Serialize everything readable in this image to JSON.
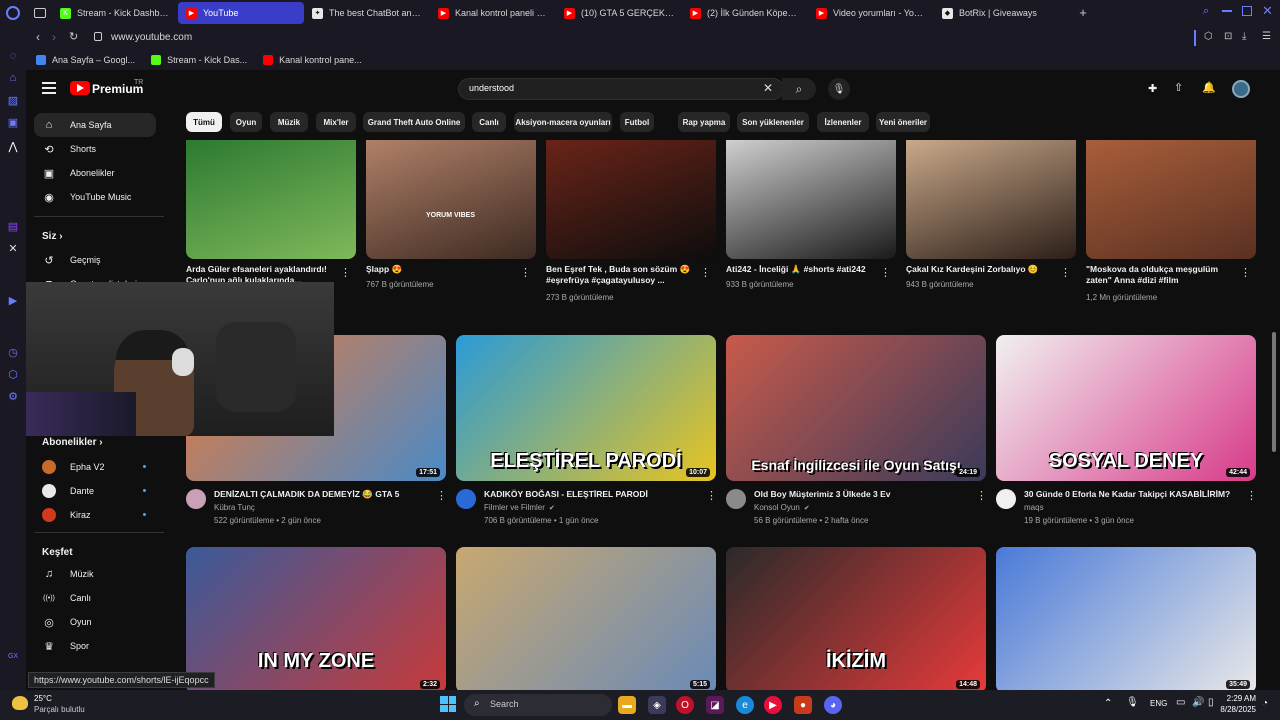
{
  "browser": {
    "tabs": [
      {
        "label": "Stream - Kick Dashboard",
        "color": "#53fc18",
        "glyph": "K"
      },
      {
        "label": "YouTube",
        "color": "#ff0000",
        "glyph": "▶",
        "active": true
      },
      {
        "label": "The best ChatBot and W...",
        "color": "#e8e8e8",
        "glyph": "✦"
      },
      {
        "label": "Kanal kontrol paneli - You...",
        "color": "#ff0000",
        "glyph": "▶"
      },
      {
        "label": "(10) GTA 5 GERÇEK HAYA...",
        "color": "#ff0000",
        "glyph": "▶"
      },
      {
        "label": "(2) İlk Günden Köpekbalığ...",
        "color": "#ff0000",
        "glyph": "▶"
      },
      {
        "label": "Video yorumları - YouTub...",
        "color": "#ff0000",
        "glyph": "▶"
      },
      {
        "label": "BotRix | Giveaways",
        "color": "#e8e8e8",
        "glyph": "◆"
      }
    ],
    "url": "www.youtube.com",
    "bookmarks": [
      {
        "label": "Ana Sayfa – Googl...",
        "color": "#4285f4"
      },
      {
        "label": "Stream - Kick Das...",
        "color": "#53fc18"
      },
      {
        "label": "Kanal kontrol pane...",
        "color": "#ff0000"
      }
    ],
    "status_url": "https://www.youtube.com/shorts/lE-ijEqopcc"
  },
  "youtube": {
    "logo": "Premium",
    "logo_region": "TR",
    "search_value": "understood",
    "sidebar": {
      "main": [
        {
          "label": "Ana Sayfa",
          "icon": "home-icon",
          "glyph": "⌂",
          "active": true
        },
        {
          "label": "Shorts",
          "icon": "shorts-icon",
          "glyph": "⟲"
        },
        {
          "label": "Abonelikler",
          "icon": "subscriptions-icon",
          "glyph": "▣"
        },
        {
          "label": "YouTube Music",
          "icon": "music-icon",
          "glyph": "◉"
        }
      ],
      "you_heading": "Siz",
      "you_items": [
        {
          "label": "Geçmiş",
          "icon": "history-icon",
          "glyph": "↺"
        },
        {
          "label": "Oynatma listeleri",
          "icon": "playlists-icon",
          "glyph": "≡"
        }
      ],
      "subs_heading": "Abonelikler",
      "subs": [
        {
          "label": "Epha V2",
          "color": "#c86a2a"
        },
        {
          "label": "Dante",
          "color": "#e8e8e8"
        },
        {
          "label": "Kiraz",
          "color": "#d23a1e"
        }
      ],
      "explore_heading": "Keşfet",
      "explore": [
        {
          "label": "Müzik",
          "icon": "music-note-icon",
          "glyph": "♫"
        },
        {
          "label": "Canlı",
          "icon": "live-icon",
          "glyph": "((•))"
        },
        {
          "label": "Oyun",
          "icon": "gaming-icon",
          "glyph": "◎"
        },
        {
          "label": "Spor",
          "icon": "trophy-icon",
          "glyph": "♛"
        }
      ]
    },
    "chips": [
      "Tümü",
      "Oyun",
      "Müzik",
      "Mix'ler",
      "Grand Theft Auto Online",
      "Canlı",
      "Aksiyon-macera oyunları",
      "Futbol",
      "Rap yapma",
      "Son yüklenenler",
      "İzlenenler",
      "Yeni öneriler"
    ],
    "shorts": [
      {
        "title": "Arda Güler efsaneleri ayaklandırdı! Carlo'nun ağlı kulaklarında...",
        "views": "",
        "colors": [
          "#2d7a32",
          "#7fb85a"
        ]
      },
      {
        "title": "Şlapp 😍",
        "views": "767 B görüntüleme",
        "colors": [
          "#b08068",
          "#3d2a22"
        ],
        "overlay": "YORUM VIBES"
      },
      {
        "title": "Ben Eşref Tek , Buda son sözüm 😍 #eşrefrüya #çagatayulusoy ...",
        "views": "273 B görüntüleme",
        "colors": [
          "#6a2418",
          "#0d0d0d"
        ]
      },
      {
        "title": "Ati242 - İnceliği 🙏 #shorts #ati242",
        "views": "933 B görüntüleme",
        "colors": [
          "#cfcfcf",
          "#1a1a1a"
        ]
      },
      {
        "title": "Çakal Kız Kardeşini Zorbalıyo 😊",
        "views": "943 B görüntüleme",
        "colors": [
          "#c9a98a",
          "#2c1e18"
        ]
      },
      {
        "title": "\"Moskova da oldukça meşgulüm zaten\" Anna #dizi #film",
        "views": "1,2 Mn görüntüleme",
        "colors": [
          "#a85e3a",
          "#5a3022"
        ]
      }
    ],
    "videos": [
      {
        "title": "DENİZALTI ÇALMADIK DA DEMEYİZ 😂 GTA 5",
        "channel": "Kübra Tunç",
        "verified": false,
        "views": "522 görüntüleme",
        "age": "2 gün önce",
        "duration": "17:51",
        "colors": [
          "#e87a3a",
          "#4a8ac8"
        ],
        "overlay": "",
        "avatar": "#c9a0b8"
      },
      {
        "title": "KADIKÖY BOĞASI - ELEŞTİREL PARODİ",
        "channel": "Filmler ve Filmler",
        "verified": true,
        "views": "706 B görüntüleme",
        "age": "1 gün önce",
        "duration": "10:07",
        "colors": [
          "#2a9ad8",
          "#e8c420"
        ],
        "overlay": "ELEŞTİREL PARODİ",
        "avatar": "#2a6ad8"
      },
      {
        "title": "Old Boy Müşterimiz 3 Ülkede 3 Ev",
        "channel": "Konsol Oyun",
        "verified": true,
        "views": "56 B görüntüleme",
        "age": "2 hafta önce",
        "duration": "24:19",
        "colors": [
          "#c85a4a",
          "#3a3a5a"
        ],
        "overlay": "Esnaf İngilizcesi ile Oyun Satışı",
        "avatar": "#8a8a8a"
      },
      {
        "title": "30 Günde 0 Eforla Ne Kadar Takipçi KASABİLİRİM?",
        "channel": "maqs",
        "verified": false,
        "views": "19 B görüntüleme",
        "age": "3 gün önce",
        "duration": "42:44",
        "colors": [
          "#f0f0f0",
          "#d83a8a"
        ],
        "overlay": "SOSYAL DENEY",
        "avatar": "#f0f0f0"
      },
      {
        "title": "",
        "channel": "",
        "verified": false,
        "views": "",
        "age": "",
        "duration": "2:32",
        "colors": [
          "#3a5a9a",
          "#c83a3a"
        ],
        "overlay": "IN MY ZONE",
        "avatar": ""
      },
      {
        "title": "",
        "channel": "",
        "verified": false,
        "views": "",
        "age": "",
        "duration": "5:15",
        "colors": [
          "#c8a870",
          "#6a8ab8"
        ],
        "overlay": "",
        "avatar": ""
      },
      {
        "title": "",
        "channel": "",
        "verified": false,
        "views": "",
        "age": "",
        "duration": "14:48",
        "colors": [
          "#2a2a2a",
          "#e83a3a"
        ],
        "overlay": "İKİZİM",
        "avatar": ""
      },
      {
        "title": "",
        "channel": "",
        "verified": false,
        "views": "",
        "age": "",
        "duration": "35:49",
        "colors": [
          "#4a7ad8",
          "#e8e8e8"
        ],
        "overlay": "",
        "avatar": ""
      }
    ]
  },
  "taskbar": {
    "weather_temp": "25°C",
    "weather_desc": "Parçalı bulutlu",
    "search_placeholder": "Search",
    "lang": "ENG",
    "time": "2:29 AM",
    "date": "8/28/2025"
  }
}
